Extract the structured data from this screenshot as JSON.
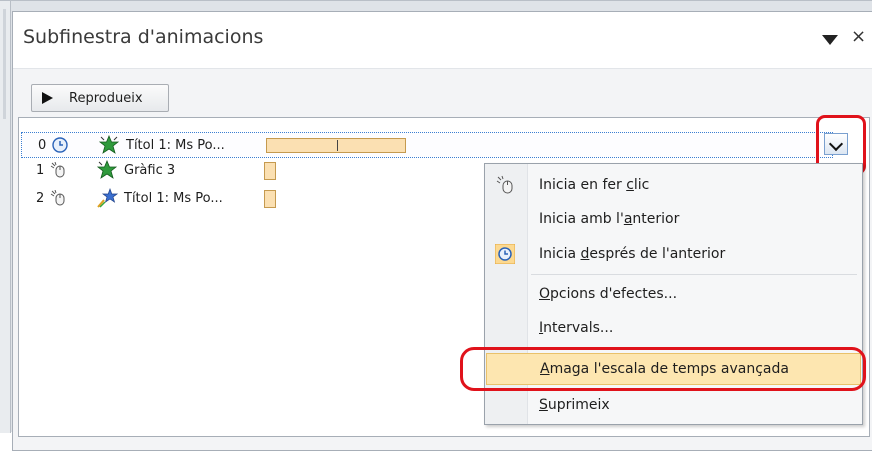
{
  "pane": {
    "title": "Subfinestra d'animacions",
    "close_glyph": "×"
  },
  "play_button": {
    "label": "Reprodueix"
  },
  "animations": [
    {
      "num": "0",
      "trigger": "clock-icon",
      "effect": "star-burst-icon",
      "name": "Títol 1: Ms Po...",
      "progress": 1.0
    },
    {
      "num": "1",
      "trigger": "mouse-click-icon",
      "effect": "star-burst-icon",
      "name": "Gràfic 3",
      "progress": 0.07
    },
    {
      "num": "2",
      "trigger": "mouse-click-icon",
      "effect": "fly-star-icon",
      "name": "Títol 1: Ms Po...",
      "progress": 0.07
    }
  ],
  "context_menu": {
    "items": [
      {
        "pre": "Inicia en fer ",
        "u": "c",
        "post": "lic"
      },
      {
        "pre": "Inicia amb l'",
        "u": "a",
        "post": "nterior"
      },
      {
        "pre": "Inicia ",
        "u": "d",
        "post": "esprés de l'anterior"
      },
      {
        "pre": "",
        "u": "O",
        "post": "pcions d'efectes..."
      },
      {
        "pre": "",
        "u": "I",
        "post": "ntervals..."
      },
      {
        "pre": "",
        "u": "A",
        "post": "maga l'escala de temps avançada"
      },
      {
        "pre": "",
        "u": "S",
        "post": "uprimeix"
      }
    ]
  },
  "colors": {
    "highlight_red": "#e0121b",
    "timeline_bar": "#fbe0b2",
    "menu_hover": "#fde6b0",
    "selection_border": "#3c7fd2"
  }
}
